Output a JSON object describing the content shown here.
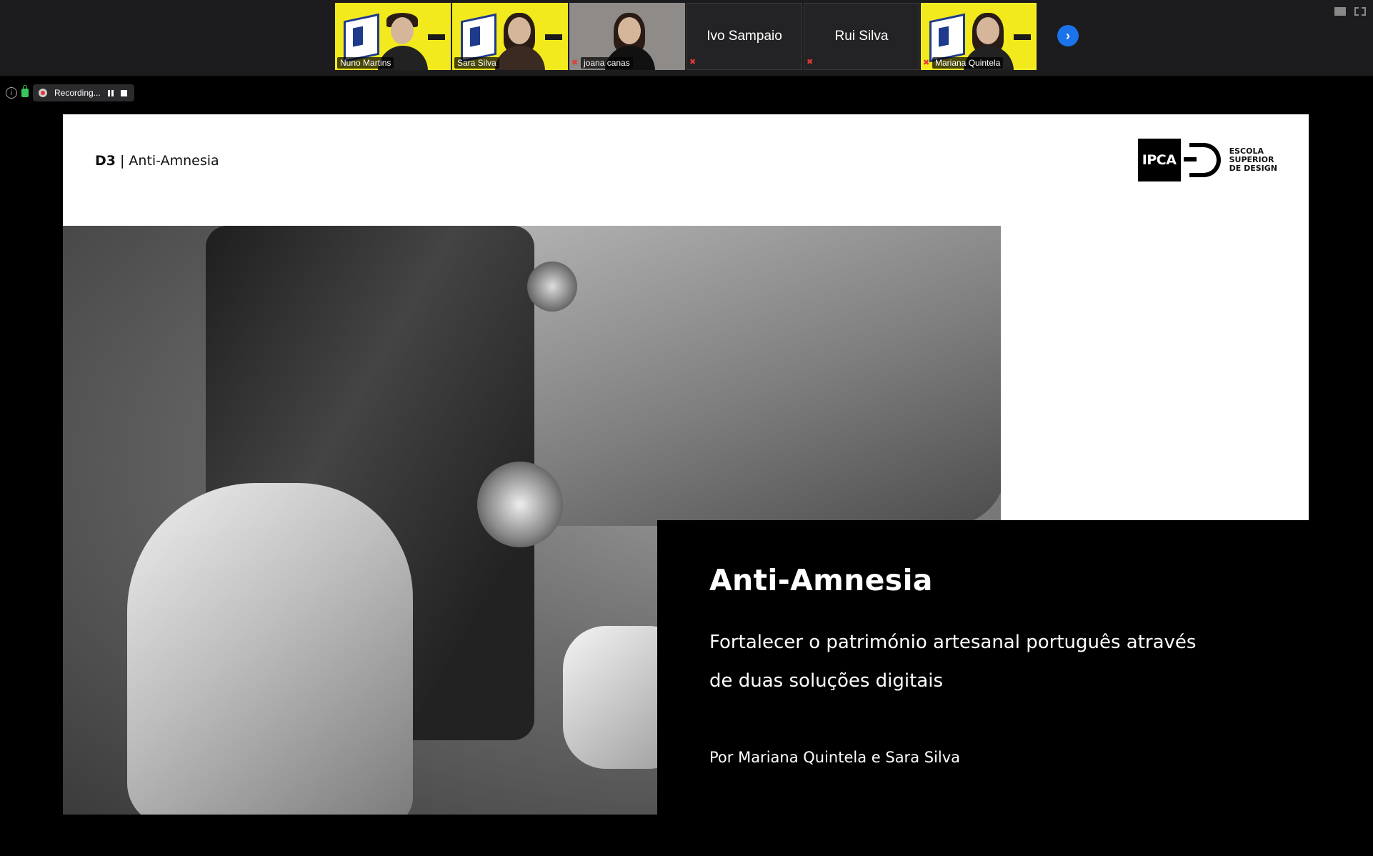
{
  "participants": [
    {
      "name": "Nuno Martins",
      "kind": "video",
      "muted": false
    },
    {
      "name": "Sara Silva",
      "kind": "video",
      "muted": false
    },
    {
      "name": "joana canas",
      "kind": "video-plain",
      "muted": true
    },
    {
      "name": "Ivo Sampaio",
      "kind": "name-only",
      "muted": true
    },
    {
      "name": "Rui Silva",
      "kind": "name-only",
      "muted": true
    },
    {
      "name": "Mariana Quintela",
      "kind": "video",
      "muted": true,
      "active": true
    }
  ],
  "recording": {
    "label": "Recording..."
  },
  "slide": {
    "project_code": "D3",
    "separator": "|",
    "project_name": "Anti-Amnesia",
    "logo_text": "IPCA",
    "school_name": "ESCOLA\nSUPERIOR\nDE DESIGN",
    "title": "Anti-Amnesia",
    "subtitle": "Fortalecer o património artesanal português através de duas soluções digitais",
    "authors": "Por Mariana Quintela e Sara Silva"
  },
  "colors": {
    "topbar": "#1c1c1e",
    "active_speaker": "#f5f02a",
    "next_button": "#1a73e8",
    "muted": "#e53935"
  }
}
